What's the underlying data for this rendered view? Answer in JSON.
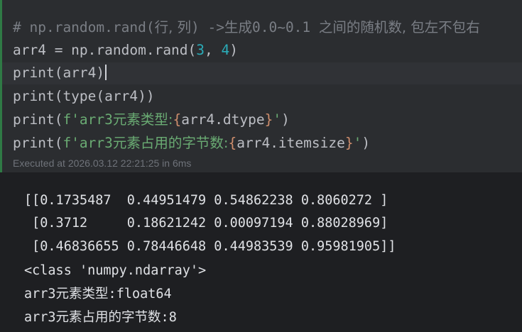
{
  "cell": {
    "lines": [
      {
        "parts": [
          {
            "t": "# np.random.rand(",
            "c": "comment"
          },
          {
            "t": "行, 列",
            "c": "comment cjk"
          },
          {
            "t": ") ->",
            "c": "comment"
          },
          {
            "t": "生成",
            "c": "comment cjk"
          },
          {
            "t": "0.0~0.1 ",
            "c": "comment"
          },
          {
            "t": "之间的随机数, 包左不包右",
            "c": "comment cjk"
          }
        ]
      },
      {
        "parts": [
          {
            "t": "arr4 = np.random.rand(",
            "c": ""
          },
          {
            "t": "3",
            "c": "num"
          },
          {
            "t": ", ",
            "c": ""
          },
          {
            "t": "4",
            "c": "num"
          },
          {
            "t": ")",
            "c": ""
          }
        ]
      },
      {
        "parts": [
          {
            "t": "print(arr4)",
            "c": ""
          }
        ]
      },
      {
        "parts": [
          {
            "t": "print(type(arr4))",
            "c": ""
          }
        ]
      },
      {
        "parts": [
          {
            "t": "print(",
            "c": ""
          },
          {
            "t": "f'arr3",
            "c": "str"
          },
          {
            "t": "元素类型:",
            "c": "str cjk"
          },
          {
            "t": "{",
            "c": "brace"
          },
          {
            "t": "arr4.dtype",
            "c": ""
          },
          {
            "t": "}",
            "c": "brace"
          },
          {
            "t": "'",
            "c": "str"
          },
          {
            "t": ")",
            "c": ""
          }
        ]
      },
      {
        "parts": [
          {
            "t": "print(",
            "c": ""
          },
          {
            "t": "f'arr3",
            "c": "str"
          },
          {
            "t": "元素占用的字节数:",
            "c": "str cjk"
          },
          {
            "t": "{",
            "c": "brace"
          },
          {
            "t": "arr4.itemsize",
            "c": ""
          },
          {
            "t": "}",
            "c": "brace"
          },
          {
            "t": "'",
            "c": "str"
          },
          {
            "t": ")",
            "c": ""
          }
        ]
      }
    ],
    "execution_info": "Executed at 2026.03.12 22:21:25 in 6ms"
  },
  "output": {
    "lines": [
      "[[0.1735487  0.44951479 0.54862238 0.8060272 ]",
      " [0.3712     0.18621242 0.00097194 0.88028969]",
      " [0.46836655 0.78446648 0.44983539 0.95981905]]",
      "<class 'numpy.ndarray'>",
      "arr3元素类型:float64",
      "arr3元素占用的字节数:8"
    ]
  },
  "colors": {
    "cell_background": "#2b2d30",
    "output_background": "#1e1f22",
    "gutter_success": "#2f7a45",
    "comment": "#7a7e85",
    "number": "#2aacb8",
    "string": "#6aab73",
    "brace": "#cf8e6d"
  }
}
